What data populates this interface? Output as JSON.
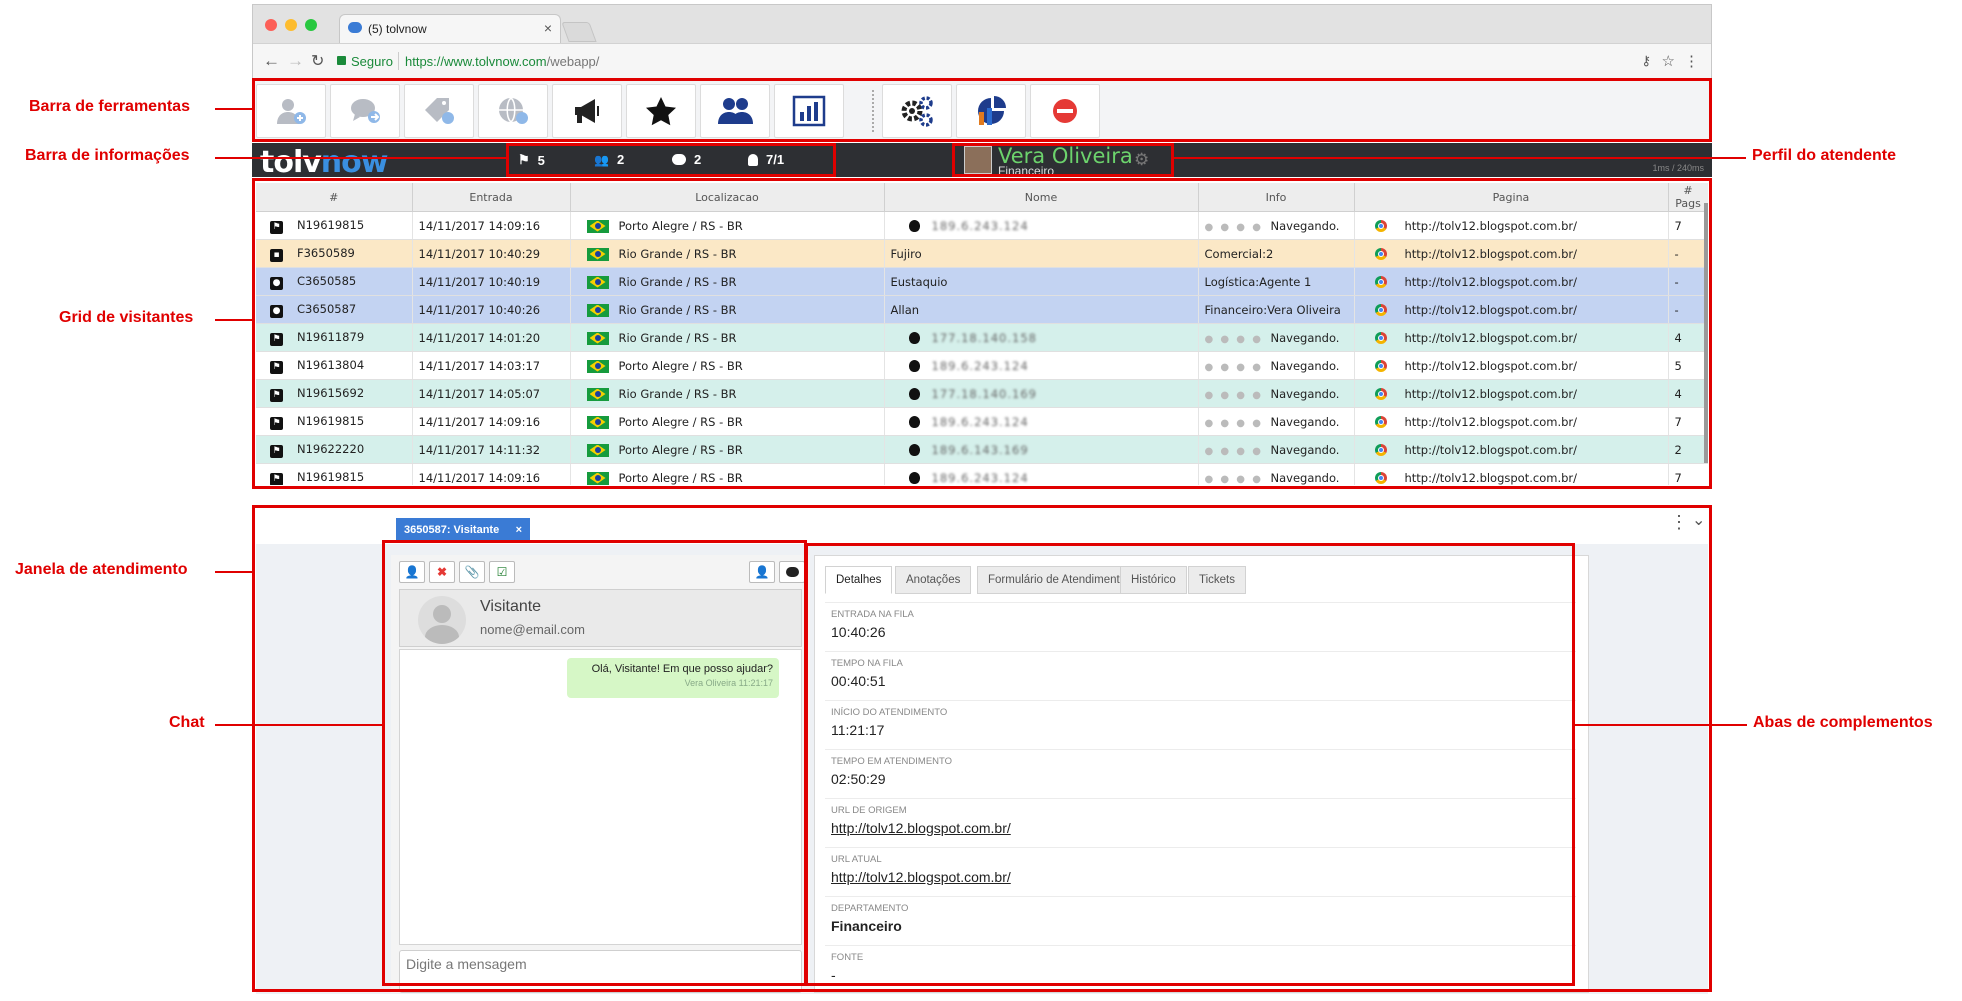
{
  "browser": {
    "tab_title": "(5) tolvnow",
    "secure_label": "Seguro",
    "url_host": "https://www.tolvnow.com",
    "url_path": "/webapp/"
  },
  "annotations": {
    "toolbar": "Barra de ferramentas",
    "infobar": "Barra de informações",
    "grid": "Grid de visitantes",
    "window": "Janela de atendimento",
    "chat": "Chat",
    "profile": "Perfil do atendente",
    "complements": "Abas de complementos"
  },
  "toolbar": {
    "buttons": [
      "add-user-icon",
      "transfer-chat-icon",
      "tag-icon",
      "globe-icon",
      "megaphone-icon",
      "star-icon",
      "users-icon",
      "stats-icon",
      "settings-icon",
      "dashboard-icon",
      "stop-icon"
    ]
  },
  "infobar": {
    "logo_a": "tolv",
    "logo_b": "now",
    "queue_count": "5",
    "groups_count": "2",
    "chats_count": "2",
    "agents_count": "7/1",
    "agent_name": "Vera Oliveira",
    "agent_dept": "Financeiro",
    "latency": "1ms / 240ms"
  },
  "grid": {
    "columns": [
      "#",
      "Entrada",
      "Localizacao",
      "Nome",
      "Info",
      "Pagina",
      "# Pags"
    ],
    "rows": [
      {
        "id": "N19619815",
        "entrada": "14/11/2017 14:09:16",
        "loc": "Porto Alegre / RS - BR",
        "nome": "189.6.243.124",
        "info": "Navegando.",
        "pagina": "http://tolv12.blogspot.com.br/",
        "pags": "7",
        "style": "white",
        "kind": "queue"
      },
      {
        "id": "F3650589",
        "entrada": "14/11/2017 10:40:29",
        "loc": "Rio Grande / RS - BR",
        "nome": "Fujiro",
        "info": "Comercial:2",
        "pagina": "http://tolv12.blogspot.com.br/",
        "pags": "-",
        "style": "orange",
        "kind": "group"
      },
      {
        "id": "C3650585",
        "entrada": "14/11/2017 10:40:19",
        "loc": "Rio Grande / RS - BR",
        "nome": "Eustaquio",
        "info": "Logística:Agente 1",
        "pagina": "http://tolv12.blogspot.com.br/",
        "pags": "-",
        "style": "blue",
        "kind": "chat"
      },
      {
        "id": "C3650587",
        "entrada": "14/11/2017 10:40:26",
        "loc": "Rio Grande / RS - BR",
        "nome": "Allan",
        "info": "Financeiro:Vera Oliveira",
        "pagina": "http://tolv12.blogspot.com.br/",
        "pags": "-",
        "style": "blue",
        "kind": "chat"
      },
      {
        "id": "N19611879",
        "entrada": "14/11/2017 14:01:20",
        "loc": "Rio Grande / RS - BR",
        "nome": "177.18.140.158",
        "info": "Navegando.",
        "pagina": "http://tolv12.blogspot.com.br/",
        "pags": "4",
        "style": "teal",
        "kind": "queue"
      },
      {
        "id": "N19613804",
        "entrada": "14/11/2017 14:03:17",
        "loc": "Porto Alegre / RS - BR",
        "nome": "189.6.243.124",
        "info": "Navegando.",
        "pagina": "http://tolv12.blogspot.com.br/",
        "pags": "5",
        "style": "white",
        "kind": "queue"
      },
      {
        "id": "N19615692",
        "entrada": "14/11/2017 14:05:07",
        "loc": "Rio Grande / RS - BR",
        "nome": "177.18.140.169",
        "info": "Navegando.",
        "pagina": "http://tolv12.blogspot.com.br/",
        "pags": "4",
        "style": "teal",
        "kind": "queue"
      },
      {
        "id": "N19619815",
        "entrada": "14/11/2017 14:09:16",
        "loc": "Porto Alegre / RS - BR",
        "nome": "189.6.243.124",
        "info": "Navegando.",
        "pagina": "http://tolv12.blogspot.com.br/",
        "pags": "7",
        "style": "white",
        "kind": "queue"
      },
      {
        "id": "N19622220",
        "entrada": "14/11/2017 14:11:32",
        "loc": "Porto Alegre / RS - BR",
        "nome": "189.6.143.169",
        "info": "Navegando.",
        "pagina": "http://tolv12.blogspot.com.br/",
        "pags": "2",
        "style": "teal",
        "kind": "queue"
      },
      {
        "id": "N19619815",
        "entrada": "14/11/2017 14:09:16",
        "loc": "Porto Alegre / RS - BR",
        "nome": "189.6.243.124",
        "info": "Navegando.",
        "pagina": "http://tolv12.blogspot.com.br/",
        "pags": "7",
        "style": "white",
        "kind": "queue"
      }
    ]
  },
  "attendance": {
    "tab_label": "3650587: Visitante",
    "tab_close": "×",
    "visitor_name": "Visitante",
    "visitor_email": "nome@email.com",
    "message_text": "Olá, Visitante! Em que posso ajudar?",
    "message_meta": "Vera Oliveira 11:21:17",
    "compose_placeholder": "Digite a mensagem"
  },
  "complements": {
    "tabs": [
      "Detalhes",
      "Anotações",
      "Formulário de Atendimento",
      "Histórico",
      "Tickets"
    ],
    "fields": [
      {
        "label": "Entrada na fila",
        "value": "10:40:26"
      },
      {
        "label": "Tempo na fila",
        "value": "00:40:51"
      },
      {
        "label": "Início do atendimento",
        "value": "11:21:17"
      },
      {
        "label": "Tempo em atendimento",
        "value": "02:50:29"
      },
      {
        "label": "URL de origem",
        "value": "http://tolv12.blogspot.com.br/"
      },
      {
        "label": "URL atual",
        "value": "http://tolv12.blogspot.com.br/"
      },
      {
        "label": "Departamento",
        "value": "Financeiro"
      },
      {
        "label": "Fonte",
        "value": "-"
      }
    ]
  },
  "colors": {
    "accent": "#3a7bd5",
    "annotation": "#e00000",
    "agent_name": "#6cd36c"
  }
}
